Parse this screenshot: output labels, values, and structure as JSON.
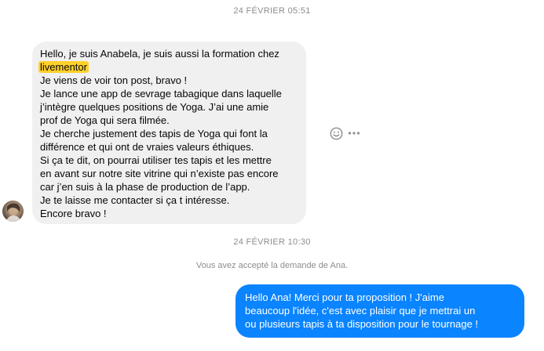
{
  "conversation": {
    "timestamp_1": "24 FÉVRIER 05:51",
    "incoming_message": {
      "lines_before_highlight": [
        "Hello, je suis Anabela, je suis aussi la formation chez"
      ],
      "highlighted": "livementor",
      "lines_after_highlight": [
        "Je viens de voir ton post, bravo !",
        "Je lance une app de sevrage tabagique dans laquelle",
        "j’intègre quelques positions de Yoga. J’ai une amie",
        "prof de Yoga qui sera filmée.",
        "Je cherche justement des tapis de Yoga qui font la",
        "différence et qui ont de vraies valeurs éthiques.",
        "Si ça te dit, on pourrai utiliser tes tapis et les mettre",
        "en avant sur notre site vitrine qui n’existe pas encore",
        "car j’en suis à la phase de production de l’app.",
        "Je te laisse me contacter si ça t intéresse.",
        "Encore bravo !"
      ]
    },
    "timestamp_2": "24 FÉVRIER 10:30",
    "system_notice": "Vous avez accepté la demande de Ana.",
    "outgoing_message": {
      "lines": [
        "Hello Ana! Merci pour ta proposition ! J'aime",
        "beaucoup l'idée, c'est avec plaisir que je mettrai un",
        "ou plusieurs tapis à ta disposition pour le tournage !"
      ]
    },
    "icons": {
      "react": "smiley-face-icon",
      "more": "more-horizontal-icon",
      "avatar": "contact-avatar"
    },
    "colors": {
      "incoming_bubble": "#f0f0f0",
      "outgoing_bubble": "#0a84ff",
      "highlight": "#ffd12b",
      "meta_text": "#8a8d91"
    }
  }
}
